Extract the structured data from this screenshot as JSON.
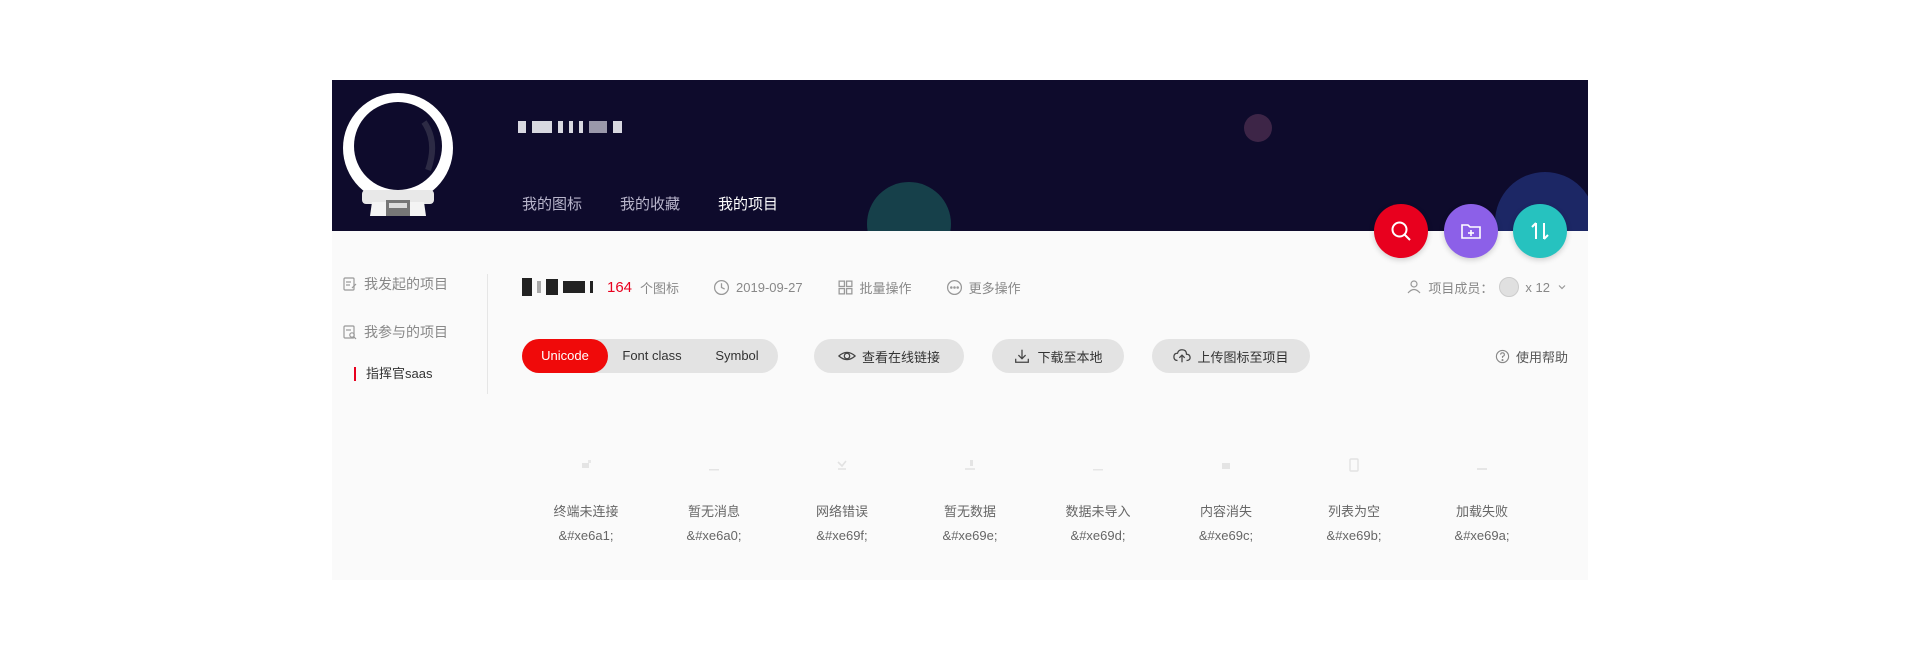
{
  "nav": {
    "tabs": [
      {
        "label": "我的图标"
      },
      {
        "label": "我的收藏"
      },
      {
        "label": "我的项目"
      }
    ]
  },
  "sidebar": {
    "started_projects": "我发起的项目",
    "joined_projects": "我参与的项目",
    "current_project": "指挥官saas"
  },
  "project": {
    "icon_count": "164",
    "icon_count_unit": "个图标",
    "date": "2019-09-27",
    "batch_ops": "批量操作",
    "more_ops": "更多操作",
    "members_label": "项目成员：",
    "members_count": "x 12"
  },
  "toolbar": {
    "format_tabs": [
      {
        "label": "Unicode",
        "active": true
      },
      {
        "label": "Font class",
        "active": false
      },
      {
        "label": "Symbol",
        "active": false
      }
    ],
    "view_link": "查看在线链接",
    "download": "下载至本地",
    "upload": "上传图标至项目",
    "help": "使用帮助"
  },
  "icons": [
    {
      "name": "终端未连接",
      "code": "&#xe6a1;"
    },
    {
      "name": "暂无消息",
      "code": "&#xe6a0;"
    },
    {
      "name": "网络错误",
      "code": "&#xe69f;"
    },
    {
      "name": "暂无数据",
      "code": "&#xe69e;"
    },
    {
      "name": "数据未导入",
      "code": "&#xe69d;"
    },
    {
      "name": "内容消失",
      "code": "&#xe69c;"
    },
    {
      "name": "列表为空",
      "code": "&#xe69b;"
    },
    {
      "name": "加载失败",
      "code": "&#xe69a;"
    }
  ],
  "colors": {
    "header_bg": "#0e0b2c",
    "accent_red": "#e8001e",
    "fab_purple": "#8c60e8",
    "fab_teal": "#26c2bf"
  }
}
